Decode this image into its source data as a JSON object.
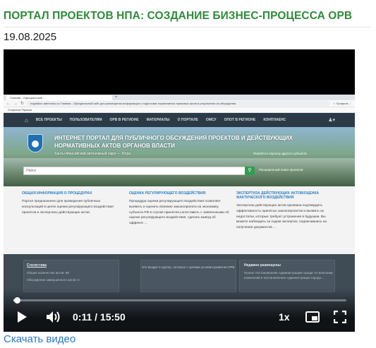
{
  "page": {
    "title": "ПОРТАЛ ПРОЕКТОВ НПА: СОЗДАНИЕ БИЗНЕС-ПРОЦЕССА ОРВ",
    "date": "19.08.2025",
    "download_label": "Скачать видео"
  },
  "player": {
    "current_time": "0:11",
    "duration": "15:50",
    "time_separator": "/",
    "speed": "1x",
    "progress_fraction": 0.0116,
    "icons": [
      "play-icon",
      "volume-icon",
      "picture-in-picture-icon",
      "fullscreen-icon"
    ]
  },
  "video_frame": {
    "browser": {
      "tab": "Главная - Официальный …",
      "address": "regulation.admhmao.ru   Главная - Официальный сайт для размещения информации о подготовке нормативных правовых актов и результатах их обсуждения",
      "right_items": "☆  Профиль  ⋮",
      "bookmarks": "Открытые Ярлыки"
    },
    "site_nav": [
      "ВСЕ ПРОЕКТЫ",
      "ПОЛЬЗОВАТЕЛЯМ",
      "ОРВ В РЕГИОНЕ",
      "МАТЕРИАЛЫ",
      "О ПОРТАЛЕ",
      "ОМСУ",
      "ОПОТ В РЕГИОНЕ",
      "КОНПЛАЕНС"
    ],
    "hero": {
      "headline": "ИНТЕРНЕТ ПОРТАЛ ДЛЯ ПУБЛИЧНОГО ОБСУЖДЕНИЯ ПРОЕКТОВ И ДЕЙСТВУЮЩИХ НОРМАТИВНЫХ АКТОВ ОРГАНОВ ВЛАСТИ",
      "subtitle": "Ханты-Мансийский автономный округ — Югра",
      "region_link": "Перейти к порталу другого субъекта",
      "search_placeholder": "Поиск",
      "extended_search": "Расширенный поиск проектов"
    },
    "columns": [
      {
        "heading": "ОБЩАЯ ИНФОРМАЦИЯ О ПРОЦЕДУРАХ",
        "text": "Портал предназначен для проведения публичных консультаций в целях оценки регулирующего воздействия проектов и экспертизы действующих актов."
      },
      {
        "heading": "ОЦЕНКА РЕГУЛИРУЮЩЕГО ВОЗДЕЙСТВИЯ",
        "text": "Процедура оценки регулирующего воздействия позволяет выявить и оценить влияние законопроекта на экономику субъекта РФ в случае принятия,сопоставить с заявленными об оценке регулирующего воздействия, сделать вывод об эффекте ..."
      },
      {
        "heading": "ЭКСПЕРТИЗА ДЕЙСТВУЮЩИХ АКТОВ/ОЦЕНКА ФАКТИЧЕСКОГО ВОЗДЕЙСТВИЯ",
        "text": "Экспертиза действующих актов призвана подтвердить эффективность принятых законопроектов и выявить их недостатки, которые требуют устранения в будущем. Вы можете наблюдать за ходом экспертиз, подписавшись на получение документов ..."
      }
    ],
    "footer": {
      "stats_heading": "Статистика",
      "stats_line1": "Общее количество актов: 98",
      "stats_line2": "Обсуждения завершенного актов: 6",
      "middle_text": "Кто входит в группу, согласно с целями условия развития ОРВ",
      "news_heading": "Недавно размещены",
      "news_text": "Проект постановления Администрации города «О внесении изменений в постановление Администрации города…"
    }
  }
}
